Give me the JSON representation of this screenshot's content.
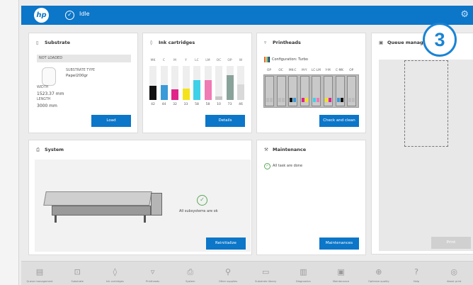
{
  "header": {
    "status": "Idle",
    "logo": "hp"
  },
  "callout": "3",
  "substrate": {
    "title": "Substrate",
    "state": "NOT LOADED",
    "type_label": "SUBSTRATE TYPE",
    "type_value": "Papel200gr",
    "width_label": "WIDTH",
    "width_value": "1523.37 mm",
    "length_label": "LENGTH",
    "length_value": "3000 mm",
    "button": "Load"
  },
  "ink": {
    "title": "Ink cartridges",
    "labels": [
      "MK",
      "C",
      "M",
      "Y",
      "LC",
      "LM",
      "OC",
      "OP",
      "W"
    ],
    "values": [
      "42",
      "44",
      "32",
      "33",
      "58",
      "58",
      "10",
      "73",
      "46"
    ],
    "levels": [
      0.42,
      0.44,
      0.32,
      0.33,
      0.58,
      0.58,
      0.1,
      0.73,
      0.46
    ],
    "colors": [
      "#111111",
      "#3b9ad8",
      "#e0248a",
      "#f4e31a",
      "#3fd1e8",
      "#f07ab4",
      "#c7c7c7",
      "#8aa39a",
      "#d9d9d9"
    ],
    "button": "Details"
  },
  "printheads": {
    "title": "Printheads",
    "configuration": "Configuration: Turbo",
    "labels": [
      "OP",
      "OC",
      "MK-C",
      "M-Y",
      "LC-LM",
      "Y-M",
      "C-MK",
      "OP"
    ],
    "button": "Check and clean"
  },
  "queue": {
    "title": "Queue management",
    "button": "Print"
  },
  "system": {
    "title": "System",
    "status": "All subsystems are ok",
    "button": "Reinitialize"
  },
  "maintenance": {
    "title": "Maintenance",
    "status": "All task are done",
    "button": "Maintenances"
  },
  "nav": [
    "Queue management",
    "Substrate",
    "Ink cartridges",
    "Printheads",
    "System",
    "Other supplies",
    "Substrate library",
    "Diagnostics",
    "Maintenance",
    "Optimize quality",
    "Help",
    "About print"
  ]
}
